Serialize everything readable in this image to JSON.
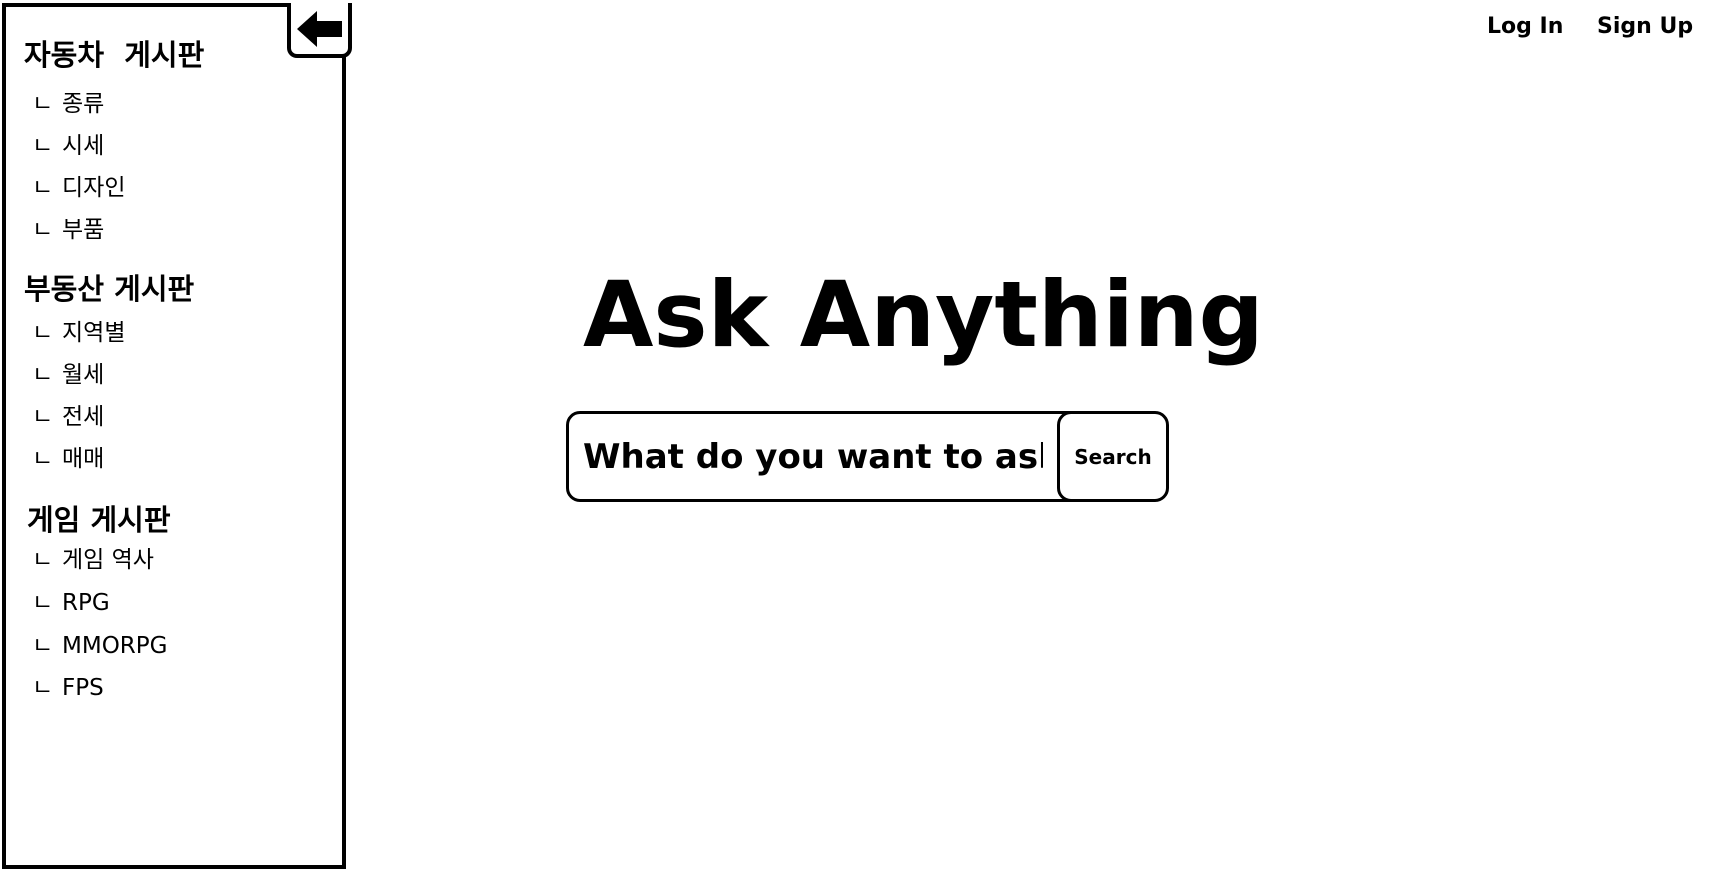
{
  "sidebar": {
    "back_icon": "arrow-left-icon",
    "branch_glyph": "ㄴ",
    "categories": [
      {
        "title": "자동차  게시판",
        "items": [
          "종류",
          "시세",
          "디자인",
          "부품"
        ]
      },
      {
        "title": "부동산 게시판",
        "items": [
          "지역별",
          "월세",
          "전세",
          "매매"
        ]
      },
      {
        "title": "게임 게시판",
        "items": [
          "게임 역사",
          "RPG",
          "MMORPG",
          "FPS"
        ]
      }
    ]
  },
  "topnav": {
    "login_label": "Log In",
    "signup_label": "Sign Up"
  },
  "main": {
    "title": "Ask Anything",
    "search_placeholder": "What do you want to ask?",
    "search_button_label": "Search"
  }
}
